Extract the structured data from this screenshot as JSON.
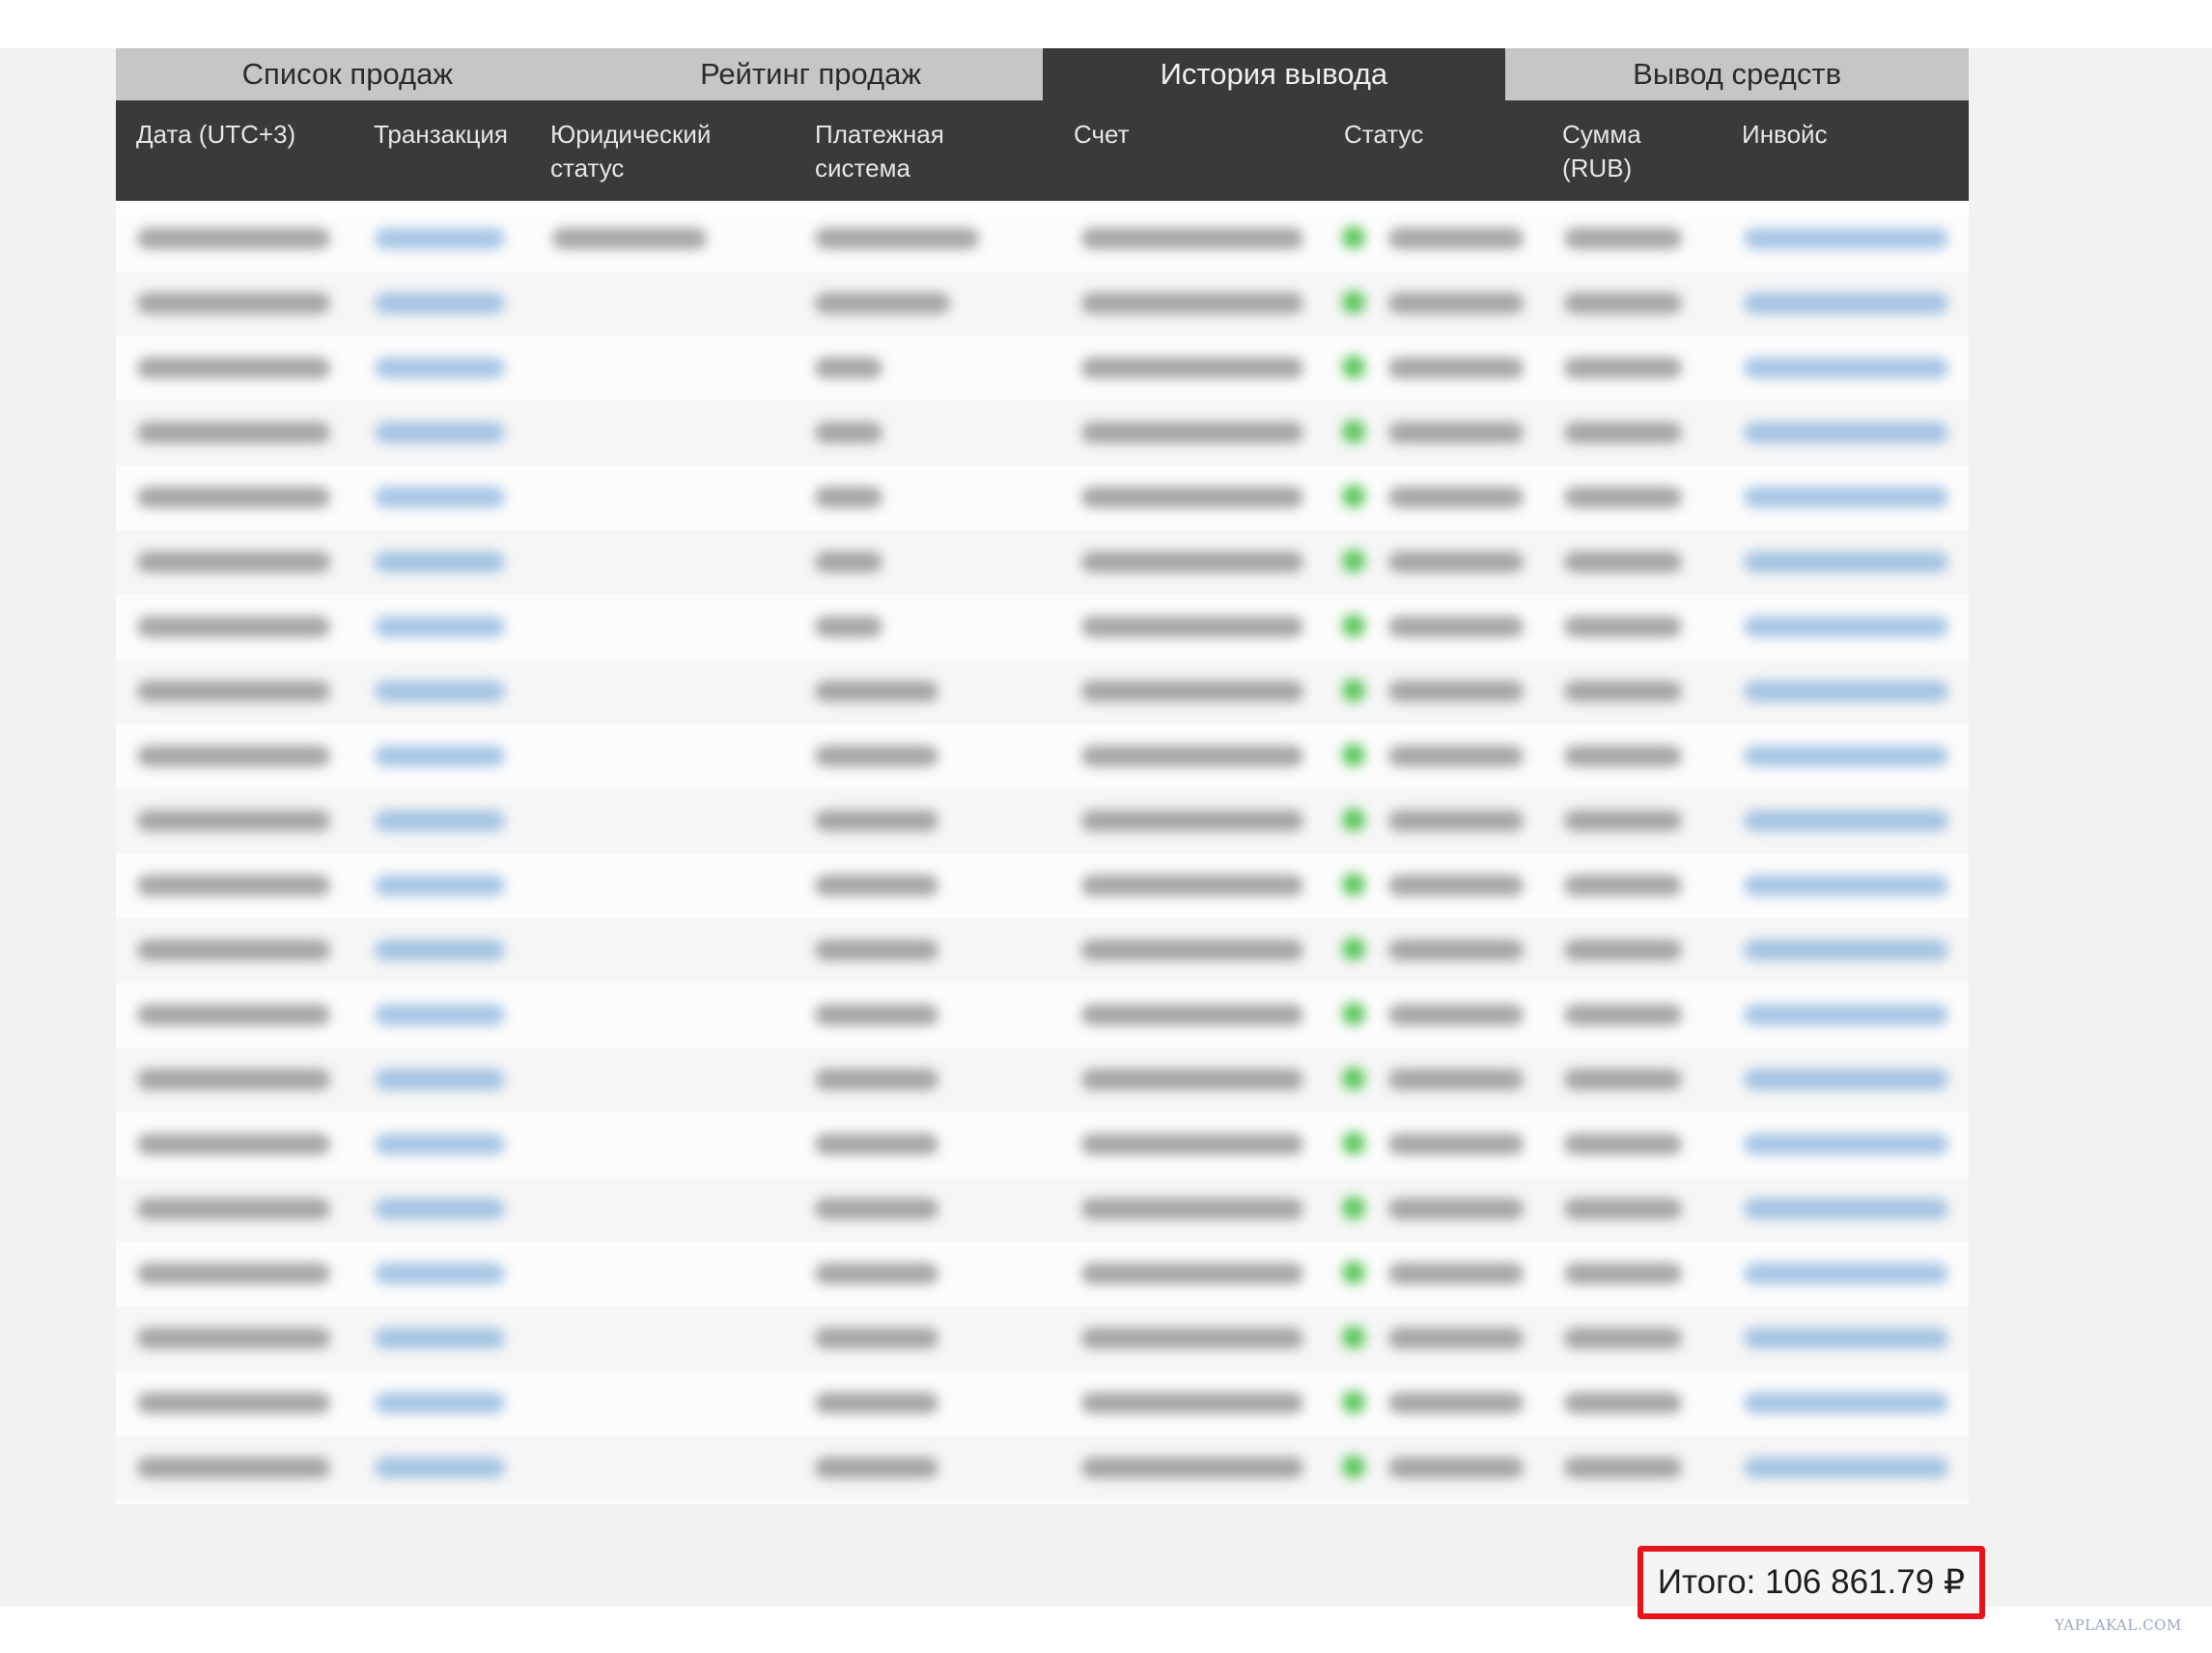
{
  "tabs": [
    {
      "label": "Список продаж",
      "active": false
    },
    {
      "label": "Рейтинг продаж",
      "active": false
    },
    {
      "label": "История вывода",
      "active": true
    },
    {
      "label": "Вывод средств",
      "active": false
    }
  ],
  "columns": [
    "Дата (UTC+3)",
    "Транзакция",
    "Юридический\nстатус",
    "Платежная\nсистема",
    "Счет",
    "Статус",
    "Сумма\n(RUB)",
    "Инвойс"
  ],
  "total": {
    "label": "Итого: 106 861.79 ₽"
  },
  "watermark": "YAPLAKAL.COM",
  "colors": {
    "tab_bar": "#c6c6c6",
    "header": "#3a3a3a",
    "highlight_box": "#e8141b",
    "status_dot": "#3fbf3f",
    "link": "#6ea3d6"
  }
}
